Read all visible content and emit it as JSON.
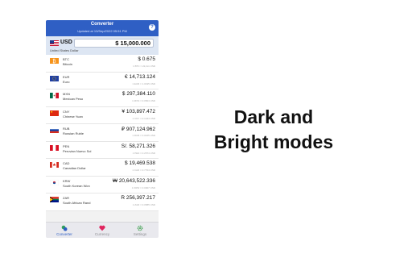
{
  "header": {
    "title": "Converter",
    "subtitle": "Updated at 13/Sep/2022 05:51 PM",
    "help_label": "?"
  },
  "base": {
    "code": "USD",
    "name": "United States Dollar",
    "amount": "$ 15,000.000"
  },
  "rows": [
    {
      "code": "BTC",
      "name": "Bitcoin",
      "value": "$ 0.675",
      "rate": "1 BTC = 22,2xx USD",
      "flag": "btc"
    },
    {
      "code": "EUR",
      "name": "Euro",
      "value": "€ 14,713.124",
      "rate": "1 EUR = 1.0195 USD",
      "flag": "eur"
    },
    {
      "code": "MXN",
      "name": "Mexican Peso",
      "value": "$ 297,384.110",
      "rate": "1 MXN = 0.0504 USD",
      "flag": "mxn"
    },
    {
      "code": "CNY",
      "name": "Chinese Yuan",
      "value": "¥ 103,897.472",
      "rate": "1 CNY = 0.1444 USD",
      "flag": "cny"
    },
    {
      "code": "RUB",
      "name": "Russian Ruble",
      "value": "₽ 907,124.962",
      "rate": "1 RUB = 0.0165 USD",
      "flag": "rub"
    },
    {
      "code": "PEN",
      "name": "Peruvian Nuevo Sol",
      "value": "S/. 58,271.326",
      "rate": "1 PEN = 0.2574 USD",
      "flag": "pen"
    },
    {
      "code": "CAD",
      "name": "Canadian Dollar",
      "value": "$ 19,469.538",
      "rate": "1 CAD = 0.7704 USD",
      "flag": "cad"
    },
    {
      "code": "KRW",
      "name": "South Korean Won",
      "value": "₩ 20,643,522.336",
      "rate": "1 KRW = 0.0007 USD",
      "flag": "krw"
    },
    {
      "code": "ZAR",
      "name": "South African Rand",
      "value": "R 256,397.217",
      "rate": "1 ZAR = 0.0585 USD",
      "flag": "zar"
    }
  ],
  "tabs": [
    {
      "label": "Converter",
      "icon": "coins-icon",
      "active": true
    },
    {
      "label": "Currency",
      "icon": "heart-icon",
      "active": false
    },
    {
      "label": "Settings",
      "icon": "gear-icon",
      "active": false
    }
  ],
  "tagline": "Dark and Bright modes",
  "colors": {
    "accent": "#2f5fc4",
    "base_bg": "#dde6f3"
  }
}
